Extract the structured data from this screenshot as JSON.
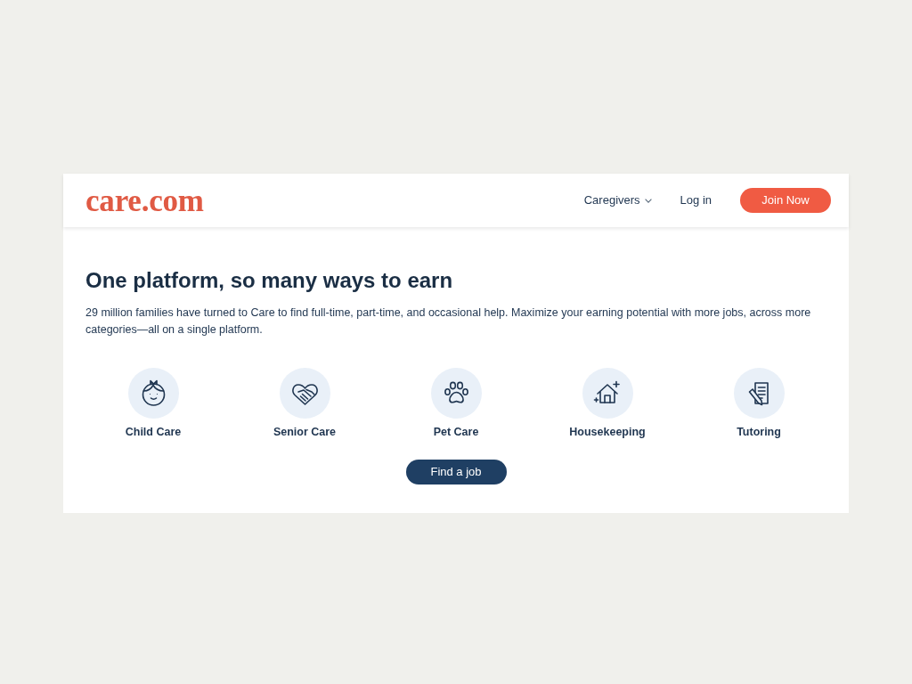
{
  "header": {
    "logo": "care.com",
    "nav": [
      {
        "label": "Caregivers",
        "kind": "dropdown"
      },
      {
        "label": "Log in",
        "kind": "link"
      }
    ],
    "cta": "Join Now"
  },
  "hero": {
    "title": "One platform, so many ways to earn",
    "description": "29 million families have turned to Care to find full-time, part-time, and occasional help. Maximize your earning potential with more jobs, across more categories—all on a single platform.",
    "categories": [
      {
        "label": "Child Care"
      },
      {
        "label": "Senior Care"
      },
      {
        "label": "Pet Care"
      },
      {
        "label": "Housekeeping"
      },
      {
        "label": "Tutoring"
      }
    ],
    "button": "Find a job"
  }
}
